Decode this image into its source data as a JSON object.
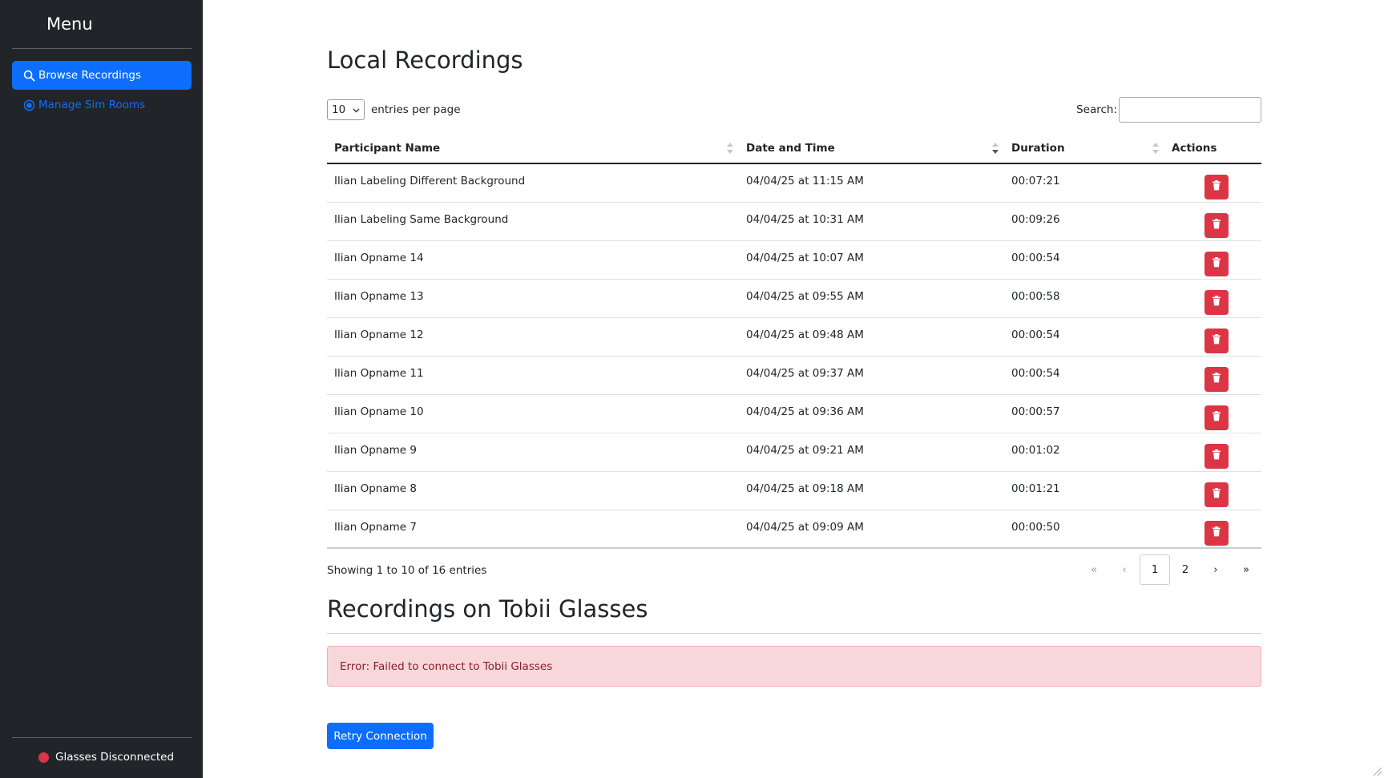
{
  "sidebar": {
    "title": "Menu",
    "items": [
      {
        "label": "Browse Recordings",
        "icon": "search-icon",
        "active": true
      },
      {
        "label": "Manage Sim Rooms",
        "icon": "target-icon",
        "active": false
      }
    ],
    "status": {
      "label": "Glasses Disconnected",
      "color": "#dc3545"
    }
  },
  "main": {
    "local_title": "Local Recordings",
    "length": {
      "value": "10",
      "suffix": "entries per page"
    },
    "search": {
      "label": "Search:",
      "value": ""
    },
    "columns": [
      "Participant Name",
      "Date and Time",
      "Duration",
      "Actions"
    ],
    "rows": [
      {
        "name": "Ilian Labeling Different Background",
        "date": "04/04/25 at 11:15 AM",
        "duration": "00:07:21"
      },
      {
        "name": "Ilian Labeling Same Background",
        "date": "04/04/25 at 10:31 AM",
        "duration": "00:09:26"
      },
      {
        "name": "Ilian Opname 14",
        "date": "04/04/25 at 10:07 AM",
        "duration": "00:00:54"
      },
      {
        "name": "Ilian Opname 13",
        "date": "04/04/25 at 09:55 AM",
        "duration": "00:00:58"
      },
      {
        "name": "Ilian Opname 12",
        "date": "04/04/25 at 09:48 AM",
        "duration": "00:00:54"
      },
      {
        "name": "Ilian Opname 11",
        "date": "04/04/25 at 09:37 AM",
        "duration": "00:00:54"
      },
      {
        "name": "Ilian Opname 10",
        "date": "04/04/25 at 09:36 AM",
        "duration": "00:00:57"
      },
      {
        "name": "Ilian Opname 9",
        "date": "04/04/25 at 09:21 AM",
        "duration": "00:01:02"
      },
      {
        "name": "Ilian Opname 8",
        "date": "04/04/25 at 09:18 AM",
        "duration": "00:01:21"
      },
      {
        "name": "Ilian Opname 7",
        "date": "04/04/25 at 09:09 AM",
        "duration": "00:00:50"
      }
    ],
    "info": "Showing 1 to 10 of 16 entries",
    "pagination": {
      "first": "«",
      "prev": "‹",
      "pages": [
        "1",
        "2"
      ],
      "current": "1",
      "next": "›",
      "last": "»"
    },
    "tobii_title": "Recordings on Tobii Glasses",
    "error": "Error: Failed to connect to Tobii Glasses",
    "retry_label": "Retry Connection"
  },
  "colors": {
    "primary": "#0d6efd",
    "danger": "#dc3545",
    "sidebar_bg": "#212529",
    "alert_bg": "#f8d7da"
  }
}
